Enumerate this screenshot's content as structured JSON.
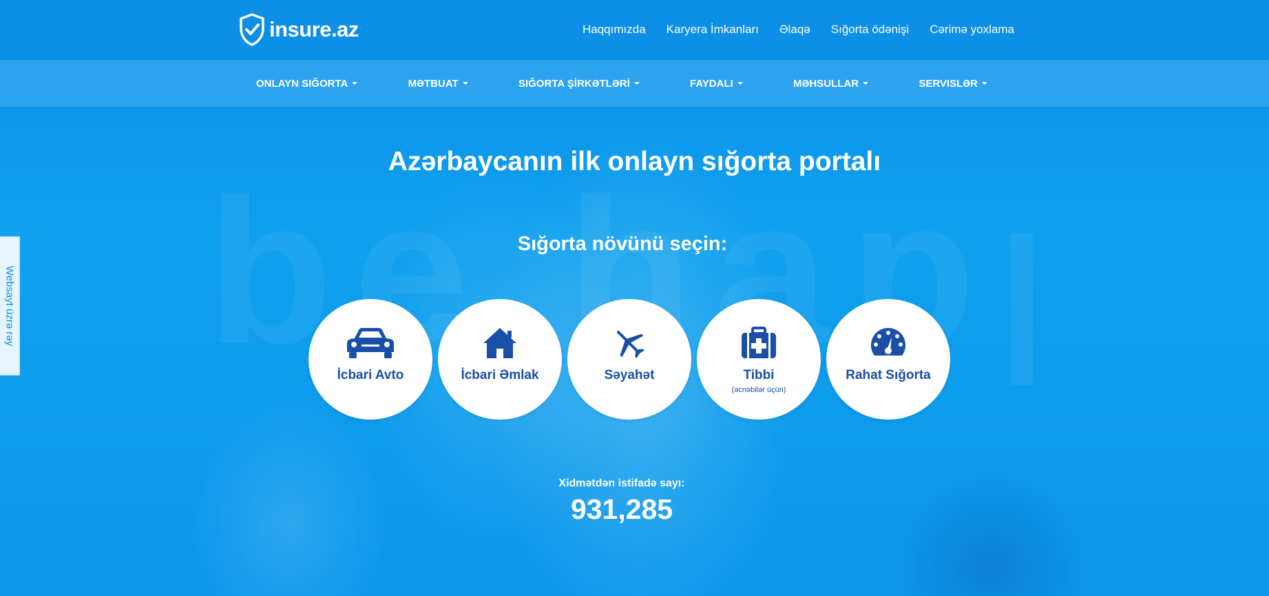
{
  "brand": {
    "name": "insure.az"
  },
  "top_links": [
    "Haqqımızda",
    "Karyera İmkanları",
    "Əlaqə",
    "Sığorta ödənişi",
    "Cərimə yoxlama"
  ],
  "main_nav": [
    "ONLAYN SIĞORTA",
    "MƏTBUAT",
    "SIĞORTA ŞİRKƏTLƏRİ",
    "FAYDALI",
    "MƏHSULLAR",
    "SERVISLƏR"
  ],
  "hero": {
    "title": "Azərbaycanın ilk onlayn sığorta portalı",
    "subtitle": "Sığorta növünü seçin:",
    "watermark": "be happy"
  },
  "insurance_types": [
    {
      "label": "İcbari Avto",
      "icon": "car-icon"
    },
    {
      "label": "İcbari Əmlak",
      "icon": "house-icon"
    },
    {
      "label": "Səyahət",
      "icon": "airplane-icon"
    },
    {
      "label": "Tibbi",
      "note": "(əcnəbilər üçün)",
      "icon": "medkit-icon"
    },
    {
      "label": "Rahat Sığorta",
      "icon": "gauge-icon"
    }
  ],
  "counter": {
    "label": "Xidmətdən istifadə sayı:",
    "value": "931,285"
  },
  "side_tab": {
    "label": "Websayt üzrə rəy"
  },
  "colors": {
    "background": "#0a98ec",
    "accent_text": "#1a4fa8",
    "nav_band": "rgba(110,190,245,0.35)"
  }
}
